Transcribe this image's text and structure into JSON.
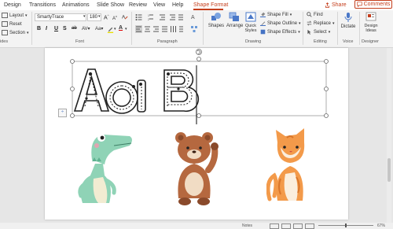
{
  "tabs": [
    {
      "label": "Design"
    },
    {
      "label": "Transitions"
    },
    {
      "label": "Animations"
    },
    {
      "label": "Slide Show"
    },
    {
      "label": "Review"
    },
    {
      "label": "View"
    },
    {
      "label": "Help"
    },
    {
      "label": "Shape Format"
    }
  ],
  "share_label": "Share",
  "comments_label": "Comments",
  "slides_group": {
    "layout": "Layout",
    "reset": "Reset",
    "section": "Section",
    "label": "ides"
  },
  "font_group": {
    "font_name": "SmartyTrace",
    "font_size": "180",
    "label": "Font",
    "bold": "B",
    "italic": "I",
    "underline": "U",
    "strike": "S",
    "shadow": "ab",
    "font_color": "A",
    "grow": "A",
    "shrink": "A"
  },
  "paragraph_group": {
    "label": "Paragraph"
  },
  "drawing_group": {
    "shapes": "Shapes",
    "arrange": "Arrange",
    "quick_styles": "Quick Styles",
    "shape_fill": "Shape Fill",
    "shape_outline": "Shape Outline",
    "shape_effects": "Shape Effects",
    "label": "Drawing"
  },
  "editing_group": {
    "find": "Find",
    "replace": "Replace",
    "select": "Select",
    "label": "Editing"
  },
  "voice_group": {
    "dictate": "Dictate",
    "label": "Voice"
  },
  "designer_group": {
    "design_ideas": "Design Ideas",
    "label": "Designer"
  },
  "slide_text": {
    "letter_a_upper": "A",
    "letter_a_lower": "a",
    "letter_b_upper": "B"
  },
  "status_bar": {
    "notes": "Notes",
    "zoom": "67%"
  },
  "colors": {
    "accent": "#c43e1c",
    "crocodile": "#8fd3b6",
    "bear": "#b5683f",
    "cat": "#f39a4a"
  }
}
